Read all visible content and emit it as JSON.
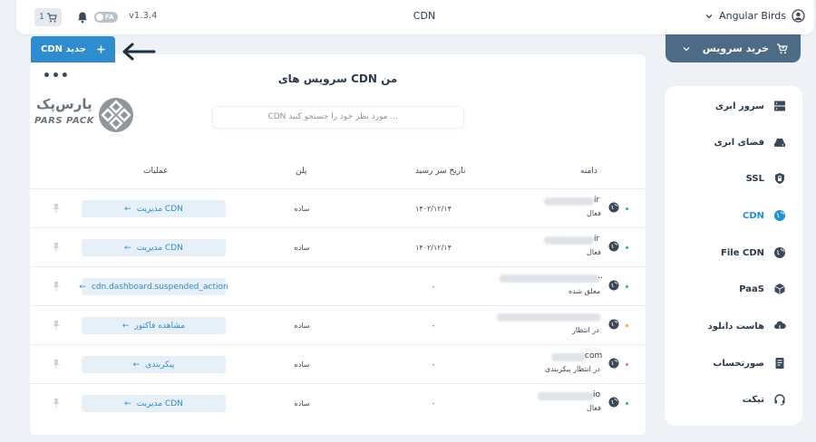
{
  "header": {
    "cart_count": "1",
    "lang_label": "FA",
    "version": "v1.3.4",
    "page_title": "CDN",
    "user_name": "Angular Birds"
  },
  "buy_button": {
    "label": "خرید سرویس"
  },
  "new_cdn_button": {
    "label": "CDN جدید"
  },
  "sidebar": {
    "items": [
      {
        "label": "سرور ابری",
        "icon": "server-icon",
        "active": false
      },
      {
        "label": "فضای ابری",
        "icon": "cloud-drive-icon",
        "active": false
      },
      {
        "label": "SSL",
        "icon": "lock-icon",
        "active": false
      },
      {
        "label": "CDN",
        "icon": "globe-icon",
        "active": true
      },
      {
        "label": "File CDN",
        "icon": "globe-icon",
        "active": false
      },
      {
        "label": "PaaS",
        "icon": "cube-icon",
        "active": false
      },
      {
        "label": "هاست دانلود",
        "icon": "cloud-download-icon",
        "active": false
      },
      {
        "label": "صورتحساب",
        "icon": "invoice-icon",
        "active": false
      },
      {
        "label": "تیکت",
        "icon": "headset-icon",
        "active": false
      }
    ]
  },
  "main": {
    "title": "سرویس های CDN من",
    "search_placeholder": "CDN مورد نظر خود را جستجو کنید ...",
    "logo": {
      "fa_text": "پارس‌پک",
      "en_text": "PARS PACK"
    },
    "columns": {
      "domain": "دامنه",
      "expiry": "تاریخ سر رسید",
      "plan": "پلن",
      "actions": "عملیات"
    },
    "rows": [
      {
        "domain_suffix": "ir",
        "status": "فعال",
        "status_color": "#2bb673",
        "expiry": "۱۴۰۲/۱۲/۱۴",
        "plan": "ساده",
        "action": "مدیریت CDN",
        "action_arrow": "←"
      },
      {
        "domain_suffix": "ir",
        "status": "فعال",
        "status_color": "#2bb673",
        "expiry": "۱۴۰۲/۱۲/۱۴",
        "plan": "ساده",
        "action": "مدیریت CDN",
        "action_arrow": "←"
      },
      {
        "domain_suffix": "..",
        "status": "معلق شده",
        "status_color": "#2bb673",
        "expiry": "-",
        "plan": "",
        "action": "cdn.dashboard.suspended_action",
        "action_arrow": "←"
      },
      {
        "domain_suffix": "",
        "status": "در انتظار",
        "status_color": "#f5a623",
        "expiry": "-",
        "plan": "ساده",
        "action": "مشاهده فاکتور",
        "action_arrow": "←"
      },
      {
        "domain_suffix": "com",
        "status": "در انتظار پیکربندی",
        "status_color": "#f06a8c",
        "expiry": "-",
        "plan": "ساده",
        "action": "پیکربندی",
        "action_arrow": "←"
      },
      {
        "domain_suffix": "io",
        "status": "فعال",
        "status_color": "#2bb673",
        "expiry": "-",
        "plan": "ساده",
        "action": "مدیریت CDN",
        "action_arrow": "←"
      }
    ]
  }
}
